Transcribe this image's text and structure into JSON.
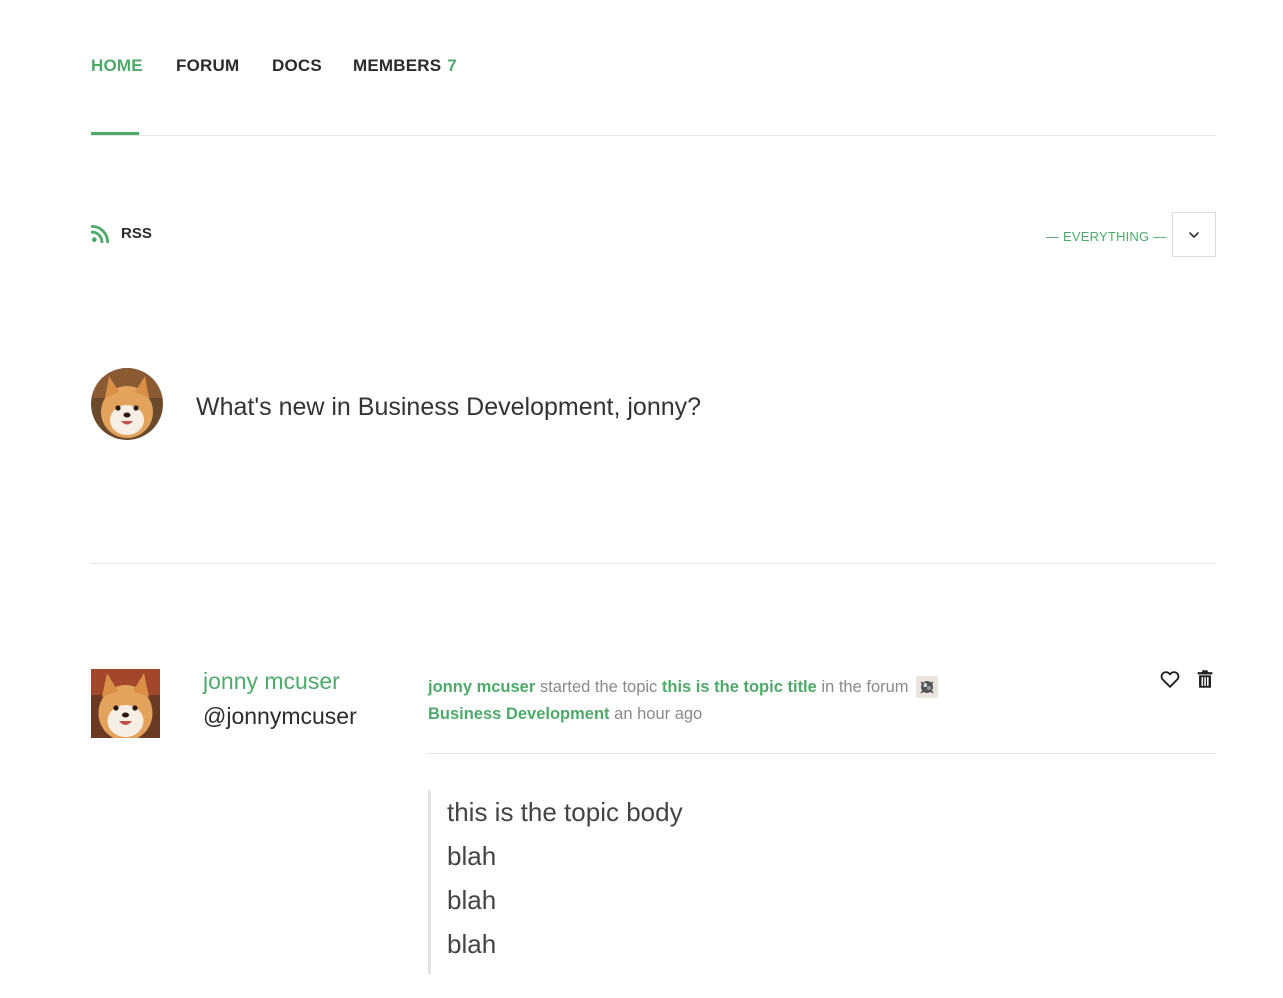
{
  "nav": {
    "home": "HOME",
    "forum": "FORUM",
    "docs": "DOCS",
    "members": "MEMBERS",
    "members_count": "7"
  },
  "toolbar": {
    "rss_label": "RSS",
    "filter_label": "— EVERYTHING —"
  },
  "post_form": {
    "prompt": "What's new in Business Development, jonny?"
  },
  "activity": {
    "user_name": "jonny mcuser",
    "user_handle": "@jonnymcuser",
    "actor": "jonny mcuser",
    "verb": "started the topic",
    "topic_title": "this is the topic title",
    "in_the_forum": "in the forum",
    "forum_name": "Business Development",
    "time_ago": "an hour ago",
    "body_lines": [
      "this is the topic body",
      "blah",
      "blah",
      "blah"
    ]
  },
  "colors": {
    "accent": "#4eaa6a",
    "text": "#2b2b2b",
    "muted": "#8a8a8a",
    "divider": "#e5e5e5"
  },
  "icons": {
    "rss": "rss-icon",
    "dropdown": "chevron-down-icon",
    "favorite": "heart-icon",
    "delete": "trash-icon"
  }
}
